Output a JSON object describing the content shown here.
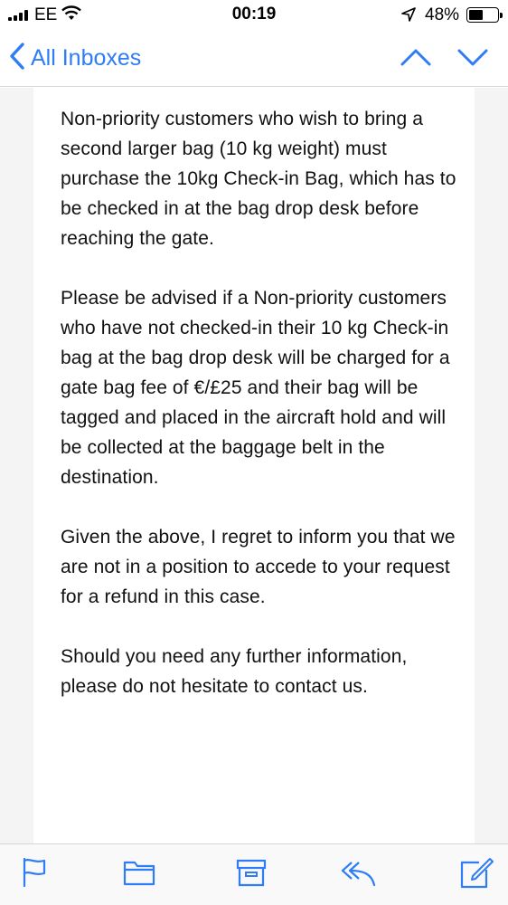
{
  "status_bar": {
    "carrier": "EE",
    "time": "00:19",
    "battery_percent": "48%",
    "battery_level": 0.48
  },
  "nav": {
    "back_label": "All Inboxes"
  },
  "message": {
    "paragraphs": [
      "Non-priority customers who wish to bring a second larger bag (10 kg weight) must purchase the 10kg Check-in Bag, which has to be checked in at the bag drop desk before reaching the gate.",
      "Please be advised if a Non-priority customers who have not checked-in their 10 kg Check-in bag at the bag drop desk will be charged for a gate bag fee of €/£25 and their bag will be tagged and placed in the aircraft hold and will be collected at the baggage belt in the destination.",
      "Given the above, I regret to inform you that we are not in a position to accede to your request for a refund in this case.",
      "Should you need any further information, please do not hesitate to contact us."
    ]
  },
  "toolbar": {
    "icons": [
      "flag-icon",
      "folder-icon",
      "archive-icon",
      "reply-icon",
      "compose-icon"
    ]
  },
  "colors": {
    "accent": "#2e7cf6",
    "background_gutter": "#f4f4f4"
  }
}
